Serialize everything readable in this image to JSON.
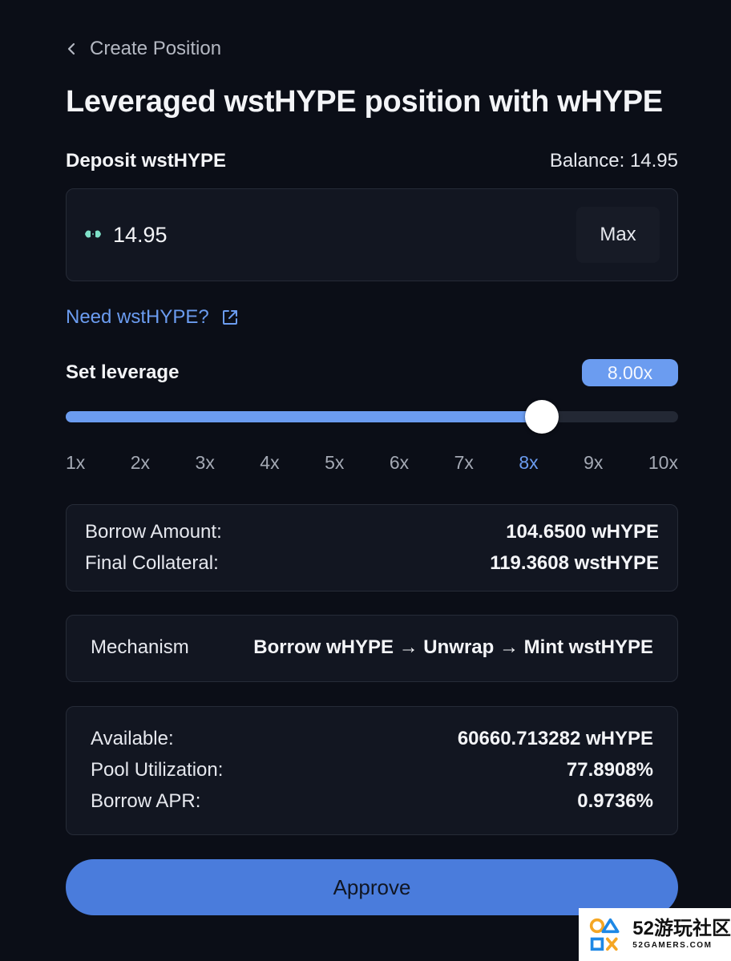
{
  "nav": {
    "back_label": "Create Position"
  },
  "title": "Leveraged wstHYPE position with wHYPE",
  "deposit": {
    "label": "Deposit wstHYPE",
    "balance": "Balance: 14.95",
    "amount_value": "14.95",
    "max_label": "Max",
    "token_icon": "wsthype-token-icon"
  },
  "need_link": {
    "label": "Need wstHYPE?",
    "icon": "external-link-icon"
  },
  "leverage": {
    "label": "Set leverage",
    "value_display": "8.00x",
    "value": 8,
    "min": 1,
    "max": 10,
    "ticks": [
      "1x",
      "2x",
      "3x",
      "4x",
      "5x",
      "6x",
      "7x",
      "8x",
      "9x",
      "10x"
    ],
    "active_tick": "8x"
  },
  "borrow_summary": {
    "borrow_amount_label": "Borrow Amount:",
    "borrow_amount_value": "104.6500 wHYPE",
    "final_collateral_label": "Final Collateral:",
    "final_collateral_value": "119.3608 wstHYPE"
  },
  "mechanism": {
    "label": "Mechanism",
    "value": "Borrow wHYPE → Unwrap → Mint wstHYPE"
  },
  "pool": {
    "available_label": "Available:",
    "available_value": "60660.713282 wHYPE",
    "utilization_label": "Pool Utilization:",
    "utilization_value": "77.8908%",
    "apr_label": "Borrow APR:",
    "apr_value": "0.9736%"
  },
  "approve_label": "Approve",
  "watermark": {
    "big": "52游玩社区",
    "small": "52GAMERS.COM"
  },
  "colors": {
    "background": "#0b0e17",
    "card": "#121621",
    "accent": "#6b9cf0",
    "button": "#4a7cdc"
  }
}
